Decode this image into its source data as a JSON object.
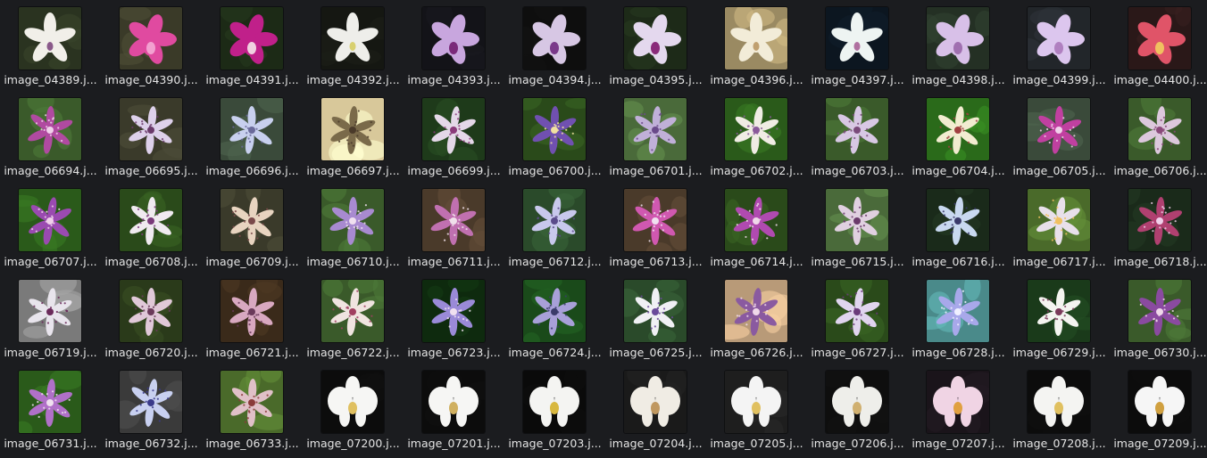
{
  "view": {
    "icon": "image-thumbnail-icon",
    "files": [
      {
        "name": "image_04389.j...",
        "style": "white",
        "bg": "#2a3320",
        "petal": "#f1efe9",
        "center": "#8a5a8a"
      },
      {
        "name": "image_04390.j...",
        "style": "cattleya",
        "bg": "#3a3a28",
        "petal": "#e04aa0",
        "center": "#f2a0d0"
      },
      {
        "name": "image_04391.j...",
        "style": "cattleya",
        "bg": "#1c2a16",
        "petal": "#c0208a",
        "center": "#f0d0e0"
      },
      {
        "name": "image_04392.j...",
        "style": "white",
        "bg": "#151712",
        "petal": "#eeeeea",
        "center": "#d8d070"
      },
      {
        "name": "image_04393.j...",
        "style": "cattleya",
        "bg": "#131318",
        "petal": "#c8a6de",
        "center": "#7a2a7a"
      },
      {
        "name": "image_04394.j...",
        "style": "cattleya",
        "bg": "#0e0e0e",
        "petal": "#d7c7e4",
        "center": "#7a3a8a"
      },
      {
        "name": "image_04395.j...",
        "style": "cattleya",
        "bg": "#1d2a18",
        "petal": "#e4d8ee",
        "center": "#8a2a7a"
      },
      {
        "name": "image_04396.j...",
        "style": "white",
        "bg": "#9a8a62",
        "petal": "#f2ecd8",
        "center": "#c0a070"
      },
      {
        "name": "image_04397.j...",
        "style": "white",
        "bg": "#0c1620",
        "petal": "#eef4f2",
        "center": "#b070a0"
      },
      {
        "name": "image_04398.j...",
        "style": "cattleya",
        "bg": "#243024",
        "petal": "#d8c0e8",
        "center": "#a070b0"
      },
      {
        "name": "image_04399.j...",
        "style": "cattleya",
        "bg": "#22262a",
        "petal": "#dcc6ee",
        "center": "#b080c0"
      },
      {
        "name": "image_04400.j...",
        "style": "cattleya",
        "bg": "#2a1818",
        "petal": "#e05468",
        "center": "#f0c060"
      },
      {
        "name": "image_06694.j...",
        "style": "toad",
        "bg": "#3a5a2a",
        "petal": "#b04aa0",
        "center": "#f0d0ea"
      },
      {
        "name": "image_06695.j...",
        "style": "toad",
        "bg": "#3a3a2a",
        "petal": "#ddd0ea",
        "center": "#6a3a6a"
      },
      {
        "name": "image_06696.j...",
        "style": "toad",
        "bg": "#3a4a3a",
        "petal": "#c8d0ee",
        "center": "#6a6a9a"
      },
      {
        "name": "image_06697.j...",
        "style": "toad",
        "bg": "#d8c89a",
        "petal": "#7a6a4a",
        "center": "#4a3a2a"
      },
      {
        "name": "image_06699.j...",
        "style": "toad",
        "bg": "#1e3a1a",
        "petal": "#e4d8e8",
        "center": "#8a3a7a"
      },
      {
        "name": "image_06700.j...",
        "style": "toad",
        "bg": "#2a4a1a",
        "petal": "#7050b0",
        "center": "#f0e0a0"
      },
      {
        "name": "image_06701.j...",
        "style": "toad",
        "bg": "#4a6a3a",
        "petal": "#c0b0d8",
        "center": "#6a4a8a"
      },
      {
        "name": "image_06702.j...",
        "style": "toad",
        "bg": "#2a5a1a",
        "petal": "#f0ece4",
        "center": "#8a5a9a"
      },
      {
        "name": "image_06703.j...",
        "style": "toad",
        "bg": "#3a5a2a",
        "petal": "#d8c8e4",
        "center": "#7a4a7a"
      },
      {
        "name": "image_06704.j...",
        "style": "toad",
        "bg": "#2a6a1a",
        "petal": "#f2ecd0",
        "center": "#a04040"
      },
      {
        "name": "image_06705.j...",
        "style": "toad",
        "bg": "#3a4a3a",
        "petal": "#c040a0",
        "center": "#f0d0ea"
      },
      {
        "name": "image_06706.j...",
        "style": "toad",
        "bg": "#3a5a2a",
        "petal": "#dcc8dc",
        "center": "#8a4a7a"
      },
      {
        "name": "image_06707.j...",
        "style": "toad",
        "bg": "#2a5a1a",
        "petal": "#9a4ab0",
        "center": "#f0d0ea"
      },
      {
        "name": "image_06708.j...",
        "style": "toad",
        "bg": "#2a4a1a",
        "petal": "#f0eaf0",
        "center": "#7a3a7a"
      },
      {
        "name": "image_06709.j...",
        "style": "toad",
        "bg": "#3a3a2a",
        "petal": "#e8d4c0",
        "center": "#7a4a4a"
      },
      {
        "name": "image_06710.j...",
        "style": "toad",
        "bg": "#3a5a2a",
        "petal": "#a88ad0",
        "center": "#f0e0f0"
      },
      {
        "name": "image_06711.j...",
        "style": "toad",
        "bg": "#4a3a2a",
        "petal": "#c070b0",
        "center": "#f0e0ea"
      },
      {
        "name": "image_06712.j...",
        "style": "toad",
        "bg": "#2a4a2a",
        "petal": "#c8c8ec",
        "center": "#5a4a8a"
      },
      {
        "name": "image_06713.j...",
        "style": "toad",
        "bg": "#4a3a2a",
        "petal": "#d058b0",
        "center": "#f0e0f0"
      },
      {
        "name": "image_06714.j...",
        "style": "toad",
        "bg": "#2a4a1a",
        "petal": "#b04ab0",
        "center": "#f0d8ea"
      },
      {
        "name": "image_06715.j...",
        "style": "toad",
        "bg": "#4a6a3a",
        "petal": "#e0d0e0",
        "center": "#6a3a6a"
      },
      {
        "name": "image_06716.j...",
        "style": "toad",
        "bg": "#1a2a1a",
        "petal": "#c8d8f0",
        "center": "#3a3a6a"
      },
      {
        "name": "image_06717.j...",
        "style": "toad",
        "bg": "#4a6a2a",
        "petal": "#e8e0ea",
        "center": "#f0c060"
      },
      {
        "name": "image_06718.j...",
        "style": "toad",
        "bg": "#1a2a1a",
        "petal": "#b04070",
        "center": "#f0d0ea"
      },
      {
        "name": "image_06719.j...",
        "style": "toad",
        "bg": "#7a7a7a",
        "petal": "#e8e4ec",
        "center": "#6a2a5a"
      },
      {
        "name": "image_06720.j...",
        "style": "toad",
        "bg": "#2a3a1a",
        "petal": "#e0c8d8",
        "center": "#6a3a5a"
      },
      {
        "name": "image_06721.j...",
        "style": "toad",
        "bg": "#3a2a1a",
        "petal": "#d8a8c0",
        "center": "#6a3a5a"
      },
      {
        "name": "image_06722.j...",
        "style": "toad",
        "bg": "#3a5a2a",
        "petal": "#f0e4e0",
        "center": "#a04060"
      },
      {
        "name": "image_06723.j...",
        "style": "toad",
        "bg": "#0e2a0e",
        "petal": "#9a8ad8",
        "center": "#f0e0f0"
      },
      {
        "name": "image_06724.j...",
        "style": "toad",
        "bg": "#1a4a1a",
        "petal": "#a8a0d8",
        "center": "#3a3a6a"
      },
      {
        "name": "image_06725.j...",
        "style": "toad",
        "bg": "#2a4a2a",
        "petal": "#f0f0f4",
        "center": "#6a4a9a"
      },
      {
        "name": "image_06726.j...",
        "style": "toad",
        "bg": "#b89a78",
        "petal": "#8a5aa0",
        "center": "#f0d8ea"
      },
      {
        "name": "image_06727.j...",
        "style": "toad",
        "bg": "#2a4a1a",
        "petal": "#e0d4ee",
        "center": "#6a3a7a"
      },
      {
        "name": "image_06728.j...",
        "style": "toad",
        "bg": "#4a8a8a",
        "petal": "#a8a8ea",
        "center": "#f0f0ff"
      },
      {
        "name": "image_06729.j...",
        "style": "toad",
        "bg": "#1a3a1a",
        "petal": "#f4f4f0",
        "center": "#7a3a5a"
      },
      {
        "name": "image_06730.j...",
        "style": "toad",
        "bg": "#3a5a2a",
        "petal": "#8a4aa0",
        "center": "#f0d8ea"
      },
      {
        "name": "image_06731.j...",
        "style": "toad",
        "bg": "#2a5a1a",
        "petal": "#b070c8",
        "center": "#f0e0f0"
      },
      {
        "name": "image_06732.j...",
        "style": "toad",
        "bg": "#3a3a3a",
        "petal": "#c8d0f0",
        "center": "#3a3a8a"
      },
      {
        "name": "image_06733.j...",
        "style": "toad",
        "bg": "#4a6a2a",
        "petal": "#e0c0c8",
        "center": "#8a3a3a"
      },
      {
        "name": "image_07200.j...",
        "style": "phal",
        "bg": "#0c0c0c",
        "petal": "#f6f6f4",
        "center": "#e0c060"
      },
      {
        "name": "image_07201.j...",
        "style": "phal",
        "bg": "#0c0c0c",
        "petal": "#f6f6f4",
        "center": "#d0b060"
      },
      {
        "name": "image_07203.j...",
        "style": "phal",
        "bg": "#0a0a0a",
        "petal": "#f4f4f2",
        "center": "#d8b840"
      },
      {
        "name": "image_07204.j...",
        "style": "phal",
        "bg": "#1a1a1a",
        "petal": "#f0ece4",
        "center": "#c09860"
      },
      {
        "name": "image_07205.j...",
        "style": "phal",
        "bg": "#1e1e1e",
        "petal": "#f4f4f4",
        "center": "#e0c060"
      },
      {
        "name": "image_07206.j...",
        "style": "phal",
        "bg": "#0e0e0e",
        "petal": "#eeeeea",
        "center": "#d0b070"
      },
      {
        "name": "image_07207.j...",
        "style": "phal",
        "bg": "#1a141a",
        "petal": "#f0d4e4",
        "center": "#e0a040"
      },
      {
        "name": "image_07208.j...",
        "style": "phal",
        "bg": "#0c0c0c",
        "petal": "#f4f4f2",
        "center": "#e0c060"
      },
      {
        "name": "image_07209.j...",
        "style": "phal",
        "bg": "#0c0c0c",
        "petal": "#f6f6f6",
        "center": "#d0a040"
      }
    ]
  }
}
